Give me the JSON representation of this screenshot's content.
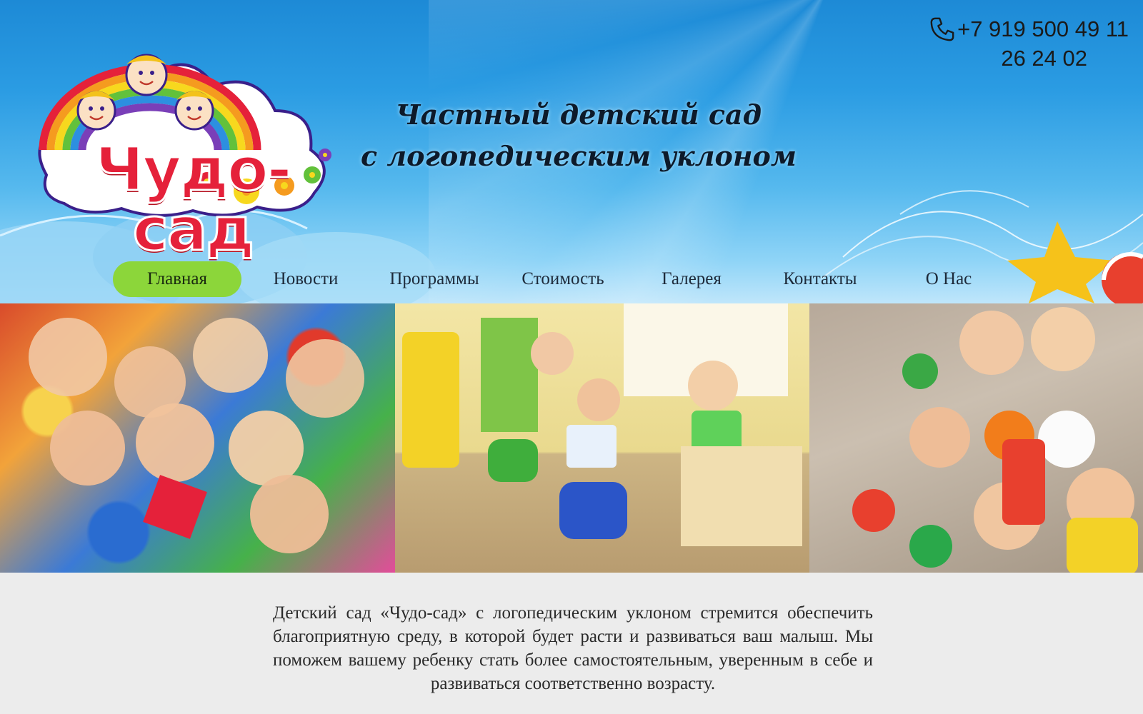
{
  "header": {
    "logo_alt": "Чудо-сад",
    "tagline_line1": "Частный детский сад",
    "tagline_line2": "с логопедическим уклоном",
    "phone_line1": "+7 919 500 49 11",
    "phone_line2": "26 24 02"
  },
  "nav": {
    "items": [
      {
        "label": "Главная",
        "active": true
      },
      {
        "label": "Новости"
      },
      {
        "label": "Программы"
      },
      {
        "label": "Стоимость"
      },
      {
        "label": "Галерея"
      },
      {
        "label": "Контакты"
      },
      {
        "label": "О Нас"
      }
    ]
  },
  "gallery": {
    "photos": [
      {
        "name": "children-group-on-carpet"
      },
      {
        "name": "children-playing-in-room"
      },
      {
        "name": "children-with-toys-on-floor"
      }
    ]
  },
  "intro": {
    "text": "Детский сад «Чудо-сад» с логопедическим уклоном стремится обеспечить благоприятную среду, в которой будет расти и развиваться ваш малыш. Мы поможем вашему ребенку стать более самостоятельным, уверенным в себе и развиваться соответственно возрасту."
  },
  "colors": {
    "nav_active": "#8cd63a",
    "logo_red": "#e5213a",
    "sky_blue": "#2b9ce3"
  }
}
